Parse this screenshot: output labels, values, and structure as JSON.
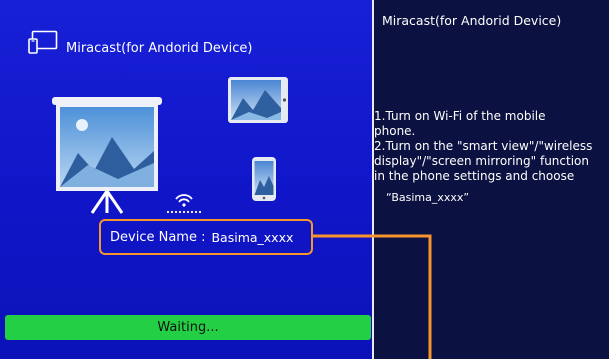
{
  "header": {
    "title": "Miracast(for Andorid Device)",
    "icon": "cast-screen-icon"
  },
  "device": {
    "label": "Device Name :",
    "value": "Basima_xxxx"
  },
  "status": {
    "text": "Waiting..."
  },
  "instructions": {
    "title": "Miracast(for Andorid Device)",
    "step1_line1": "1.Turn on Wi-Fi of the mobile",
    "step1_line2": "phone.",
    "step2_line1": "2.Turn on the \"smart view\"/\"wireless",
    "step2_line2": "display\"/\"screen mirroring\" function",
    "step2_line3": "in the phone settings and choose",
    "device_quote": "“Basima_xxxx”"
  },
  "colors": {
    "left_bg": "#1420d0",
    "right_bg": "#0b1140",
    "accent_orange": "#f6942e",
    "status_green": "#23cf45"
  }
}
